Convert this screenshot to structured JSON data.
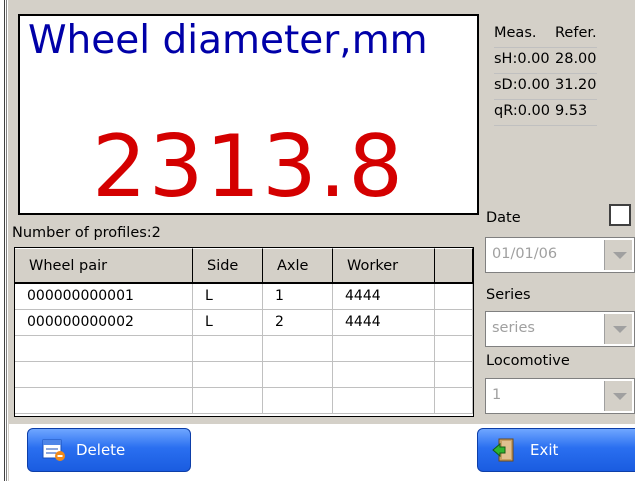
{
  "display": {
    "title": "Wheel diameter,mm",
    "value": "2313.8"
  },
  "measurements": {
    "header_meas": "Meas.",
    "header_refer": "Refer.",
    "rows": [
      {
        "meas": "sH:0.00",
        "refer": "28.00"
      },
      {
        "meas": "sD:0.00",
        "refer": "31.20"
      },
      {
        "meas": "qR:0.00",
        "refer": "9.53"
      }
    ]
  },
  "profiles": {
    "label": "Number of profiles:2",
    "columns": [
      "Wheel pair",
      "Side",
      "Axle",
      "Worker",
      ""
    ],
    "rows": [
      [
        "000000000001",
        "L",
        "1",
        "4444",
        ""
      ],
      [
        "000000000002",
        "L",
        "2",
        "4444",
        ""
      ]
    ]
  },
  "filters": {
    "date_label": "Date",
    "date_value": "01/01/06",
    "series_label": "Series",
    "series_value": "series",
    "locomotive_label": "Locomotive",
    "locomotive_value": "1"
  },
  "buttons": {
    "delete": "Delete",
    "exit": "Exit"
  },
  "colors": {
    "title": "#0000a8",
    "value": "#d40000",
    "button": "#2a6ff0"
  }
}
